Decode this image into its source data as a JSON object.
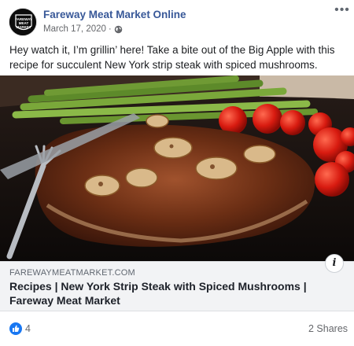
{
  "post": {
    "page_name": "Fareway Meat Market Online",
    "avatar_text": [
      "FAREWAY",
      "MEAT",
      "MARKET"
    ],
    "date": "March 17, 2020",
    "separator": "·",
    "privacy_icon": "globe-icon",
    "more_label": "•••",
    "text": "Hey watch it, I’m grillin’ here! Take a bite out of the Big Apple with this recipe for succulent New York strip steak with spiced mushrooms."
  },
  "link": {
    "domain": "FAREWAYMEATMARKET.COM",
    "title": "Recipes | New York Strip Steak with Spiced Mushrooms | Fareway Meat Market",
    "info_label": "i"
  },
  "footer": {
    "like_count": "4",
    "shares": "2 Shares"
  },
  "colors": {
    "page_name": "#385898",
    "like_blue": "#1877f2",
    "link_bg": "#f2f3f5"
  }
}
